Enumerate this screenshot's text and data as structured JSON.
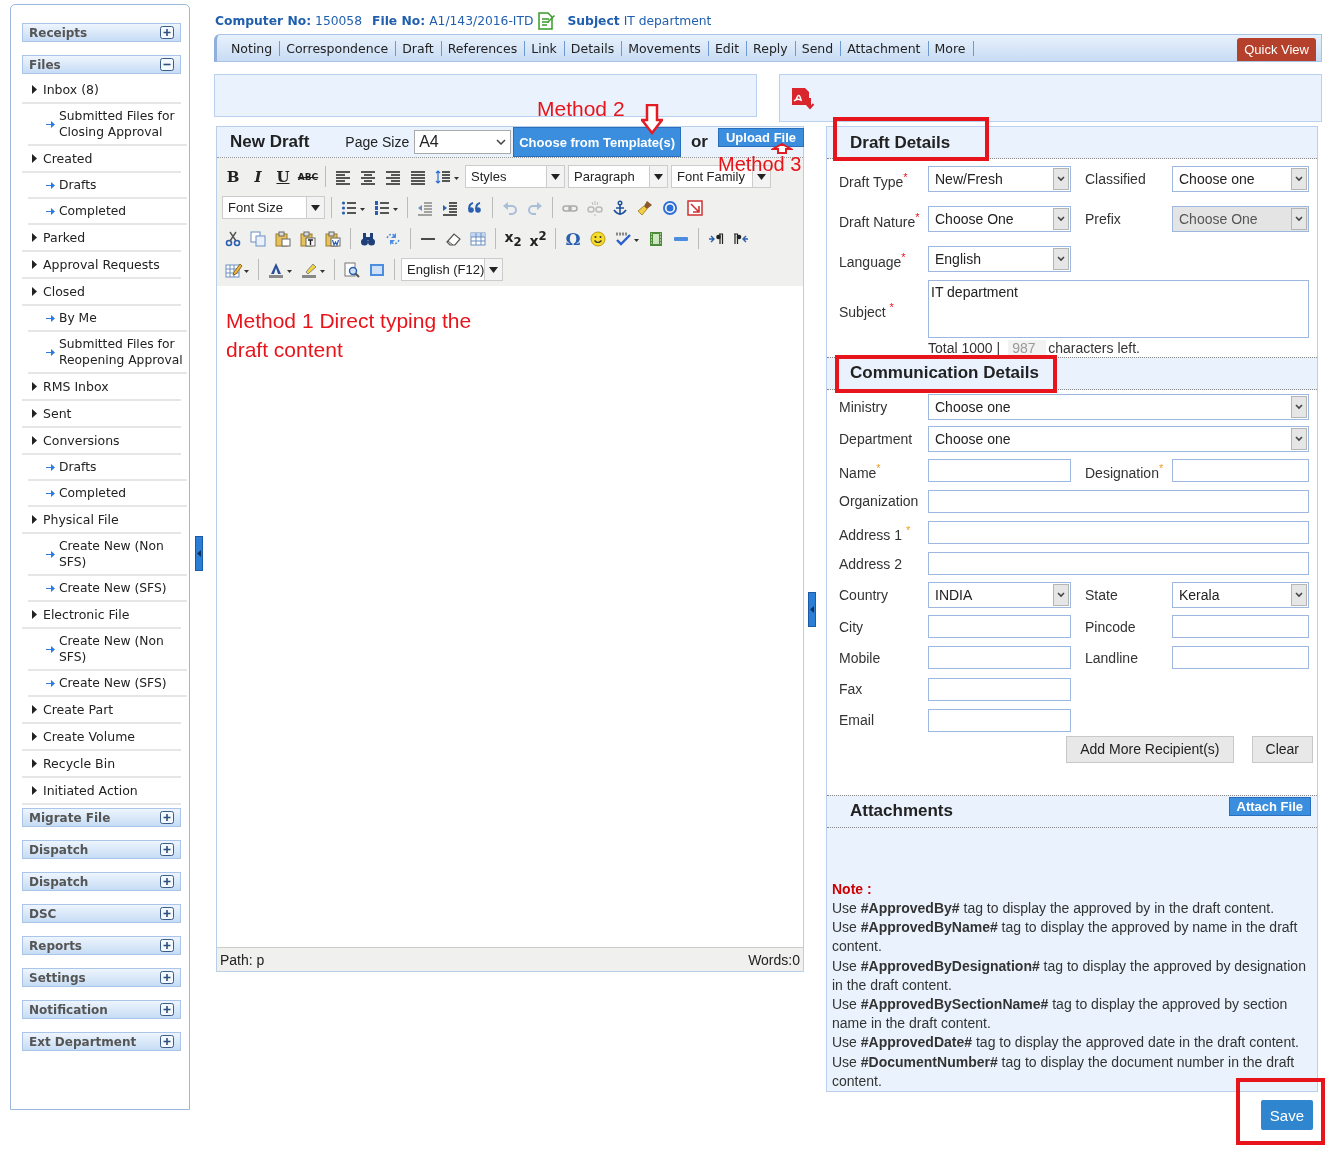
{
  "header": {
    "computer_no_label": "Computer No:",
    "computer_no": "150058",
    "file_no_label": "File No:",
    "file_no": "A1/143/2016-ITD",
    "subject_label": "Subject",
    "subject": "IT department"
  },
  "tabs": [
    {
      "label": "Noting",
      "selected": false
    },
    {
      "label": "Correspondence",
      "selected": false
    },
    {
      "label": "Draft",
      "selected": false
    },
    {
      "label": "References",
      "selected": false
    },
    {
      "label": "Link",
      "selected": false
    },
    {
      "label": "Details",
      "selected": false
    },
    {
      "label": "Movements",
      "selected": false
    },
    {
      "label": "Edit",
      "selected": false
    },
    {
      "label": "Reply",
      "selected": false
    },
    {
      "label": "Send",
      "selected": false
    },
    {
      "label": "Attachment",
      "selected": false
    },
    {
      "label": "More",
      "selected": false
    }
  ],
  "quick_view": "Quick View",
  "sidebar": {
    "panels": [
      {
        "title": "Receipts",
        "expanded": false
      },
      {
        "title": "Files",
        "expanded": true,
        "items": [
          {
            "label": "Inbox (8)",
            "children": [
              {
                "label": "Submitted Files for Closing Approval"
              }
            ]
          },
          {
            "label": "Created",
            "children": [
              {
                "label": "Drafts"
              },
              {
                "label": "Completed"
              }
            ]
          },
          {
            "label": "Parked"
          },
          {
            "label": "Approval Requests"
          },
          {
            "label": "Closed",
            "children": [
              {
                "label": "By Me"
              },
              {
                "label": "Submitted Files for Reopening Approval"
              }
            ]
          },
          {
            "label": "RMS Inbox"
          },
          {
            "label": "Sent"
          },
          {
            "label": "Conversions",
            "children": [
              {
                "label": "Drafts"
              },
              {
                "label": "Completed"
              }
            ]
          },
          {
            "label": "Physical File",
            "children": [
              {
                "label": "Create New (Non SFS)"
              },
              {
                "label": "Create New (SFS)"
              }
            ]
          },
          {
            "label": "Electronic File",
            "children": [
              {
                "label": "Create New (Non SFS)"
              },
              {
                "label": "Create New (SFS)"
              }
            ]
          },
          {
            "label": "Create Part"
          },
          {
            "label": "Create Volume"
          },
          {
            "label": "Recycle Bin"
          },
          {
            "label": "Initiated Action"
          }
        ]
      },
      {
        "title": "Migrate File",
        "expanded": false
      },
      {
        "title": "Dispatch",
        "expanded": false
      },
      {
        "title": "Dispatch",
        "expanded": false
      },
      {
        "title": "DSC",
        "expanded": false
      },
      {
        "title": "Reports",
        "expanded": false
      },
      {
        "title": "Settings",
        "expanded": false
      },
      {
        "title": "Notification",
        "expanded": false
      },
      {
        "title": "Ext Department",
        "expanded": false
      }
    ]
  },
  "editor": {
    "title": "New Draft",
    "page_size_label": "Page Size",
    "page_size": "A4",
    "template_button": "Choose from Template(s)",
    "or": "or",
    "upload_button": "Upload File",
    "annotations": {
      "method_2": "Method 2",
      "method_3": "Method 3"
    },
    "toolbar": {
      "glyphs": [
        "B",
        "I",
        "U",
        "ABC",
        "x$_{2}$",
        "x$^{2}$",
        "Ω"
      ],
      "selects": [
        "Styles",
        "Paragraph",
        "Font Family",
        "Font Size",
        "English (F12)"
      ]
    },
    "content": "Method 1 Direct typing the draft content",
    "path": "Path: p",
    "words": "Words:0"
  },
  "right_panel": {
    "draft_details": {
      "title": "Draft Details",
      "highlighted": true,
      "rows": [
        [
          {
            "label": "Draft Type$^{*}$",
            "kind": "select",
            "value": "New/Fresh",
            "disabled": false
          },
          {
            "label": "Classified",
            "kind": "select",
            "value": "Choose one",
            "disabled": false
          }
        ],
        [
          {
            "label": "Draft Nature$^{*}$",
            "kind": "select",
            "value": "Choose One",
            "disabled": false
          },
          {
            "label": "Prefix",
            "kind": "select",
            "value": "Choose One",
            "disabled": true
          }
        ],
        [
          {
            "label": "Language$^{*}$",
            "kind": "select",
            "value": "English",
            "disabled": false
          }
        ],
        [
          {
            "label": "Subject $^{*}$",
            "kind": "textarea",
            "value": "IT department"
          }
        ]
      ],
      "counter": {
        "total": "Total 1000 |",
        "remaining": "987",
        "suffix": "characters left."
      }
    },
    "communication": {
      "title": "Communication Details",
      "highlighted": true,
      "rows": [
        [
          {
            "label": "Ministry",
            "kind": "wide-select",
            "value": "Choose one",
            "disabled": false
          }
        ],
        [
          {
            "label": "Department",
            "kind": "wide-select",
            "value": "Choose one",
            "disabled": false
          }
        ],
        [
          {
            "label": "Name$^{*}$",
            "kind": "input"
          },
          {
            "label": "Designation$^{*}$",
            "kind": "input"
          }
        ],
        [
          {
            "label": "Organization",
            "kind": "wide-input"
          }
        ],
        [
          {
            "label": "Address 1 $^{*}$",
            "kind": "wide-input"
          }
        ],
        [
          {
            "label": "Address 2",
            "kind": "wide-input"
          }
        ],
        [
          {
            "label": "Country",
            "kind": "select",
            "value": "INDIA",
            "disabled": false
          },
          {
            "label": "State",
            "kind": "select",
            "value": "Kerala",
            "disabled": false
          }
        ],
        [
          {
            "label": "City",
            "kind": "input"
          },
          {
            "label": "Pincode",
            "kind": "input"
          }
        ],
        [
          {
            "label": "Mobile",
            "kind": "input"
          },
          {
            "label": "Landline",
            "kind": "input"
          }
        ],
        [
          {
            "label": "Fax",
            "kind": "input"
          }
        ],
        [
          {
            "label": "Email",
            "kind": "input"
          }
        ]
      ],
      "buttons": [
        "Add More Recipient(s)",
        "Clear"
      ]
    },
    "attachments": {
      "title": "Attachments",
      "button": "Attach File",
      "note_title": "Note :",
      "note_lines": [
        "Use **#ApprovedBy#** tag to display the approved by in the draft content.",
        "Use **#ApprovedByName#** tag to display the approved by name in the draft content.",
        "Use **#ApprovedByDesignation#** tag to display the approved by designation in the draft content.",
        "Use **#ApprovedBySectionName#** tag to display the approved by section name in the draft content.",
        "Use **#ApprovedDate#** tag to display the approved date in the draft content.",
        "Use **#DocumentNumber#** tag to display the document number in the draft content."
      ]
    }
  },
  "save": {
    "label": "Save",
    "highlighted": true
  }
}
